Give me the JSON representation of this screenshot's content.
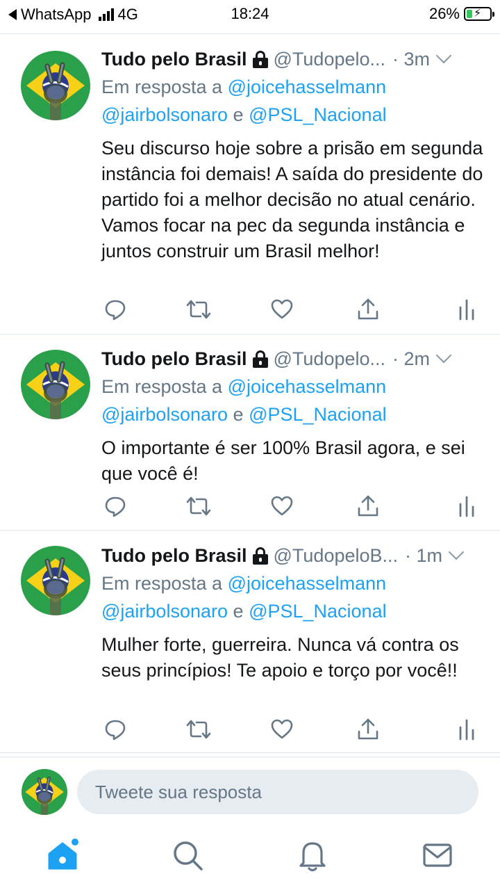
{
  "status_bar": {
    "back_app": "WhatsApp",
    "network": "4G",
    "time": "18:24",
    "battery": "26%"
  },
  "colors": {
    "link": "#1da1f2",
    "secondary": "#657786",
    "icon": "#657786",
    "brazil_green": "#2aa04a",
    "brazil_yellow": "#f7d117",
    "brazil_blue": "#2b3a8f"
  },
  "tweets": [
    {
      "name": "Tudo pelo Brasil",
      "handle": "@Tudopelo...",
      "time": "· 3m",
      "reply_prefix": "Em resposta a",
      "mention1": "@joicehasselmann",
      "mention2": "@jairbolsonaro",
      "reply_and": "e",
      "mention3": "@PSL_Nacional",
      "text": "Seu discurso hoje sobre a prisão em segunda instância foi demais! A saída do presidente do partido foi a melhor decisão no atual cenário. Vamos focar na pec da segunda instância e juntos construir um Brasil melhor!"
    },
    {
      "name": "Tudo pelo Brasil",
      "handle": "@Tudopelo...",
      "time": "· 2m",
      "reply_prefix": "Em resposta a",
      "mention1": "@joicehasselmann",
      "mention2": "@jairbolsonaro",
      "reply_and": "e",
      "mention3": "@PSL_Nacional",
      "text": "O importante é ser 100% Brasil agora, e sei que você é!"
    },
    {
      "name": "Tudo pelo Brasil",
      "handle": "@TudopeloB...",
      "time": "· 1m",
      "reply_prefix": "Em resposta a",
      "mention1": "@joicehasselmann",
      "mention2": "@jairbolsonaro",
      "reply_and": "e",
      "mention3": "@PSL_Nacional",
      "text": "Mulher forte, guerreira. Nunca vá contra os seus princípios! Te apoio e torço por você!!"
    }
  ],
  "action_icons": [
    "reply-icon",
    "retweet-icon",
    "like-icon",
    "share-icon",
    "analytics-icon"
  ],
  "reply_bar": {
    "placeholder": "Tweete sua resposta"
  },
  "tab_bar": {
    "icons": [
      "home-icon",
      "search-icon",
      "notifications-icon",
      "messages-icon"
    ],
    "active": "home-icon"
  }
}
